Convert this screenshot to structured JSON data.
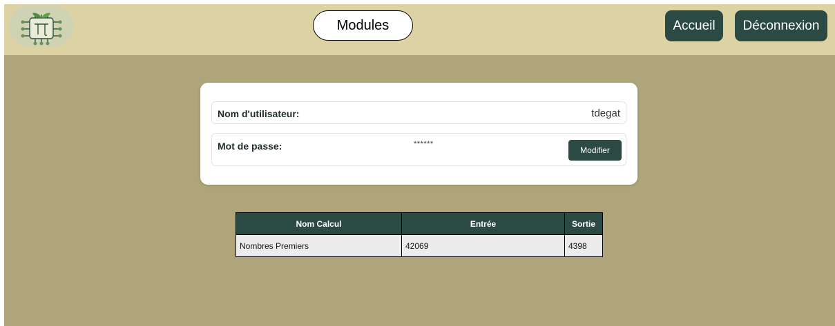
{
  "header": {
    "logo_icon": "pi-seedling-logo-icon",
    "modules_label": "Modules",
    "accueil_label": "Accueil",
    "deconnexion_label": "Déconnexion"
  },
  "profile": {
    "username_label": "Nom d'utilisateur:",
    "username_value": "tdegat",
    "password_label": "Mot de passe:",
    "password_value": "******",
    "modify_label": "Modifier"
  },
  "calc_table": {
    "headers": [
      "Nom Calcul",
      "Entrée",
      "Sortie"
    ],
    "rows": [
      [
        "Nombres Premiers",
        "42069",
        "4398"
      ]
    ]
  },
  "colors": {
    "topbar": "#dcd2a3",
    "background": "#aea57b",
    "accent": "#2a4a43"
  }
}
